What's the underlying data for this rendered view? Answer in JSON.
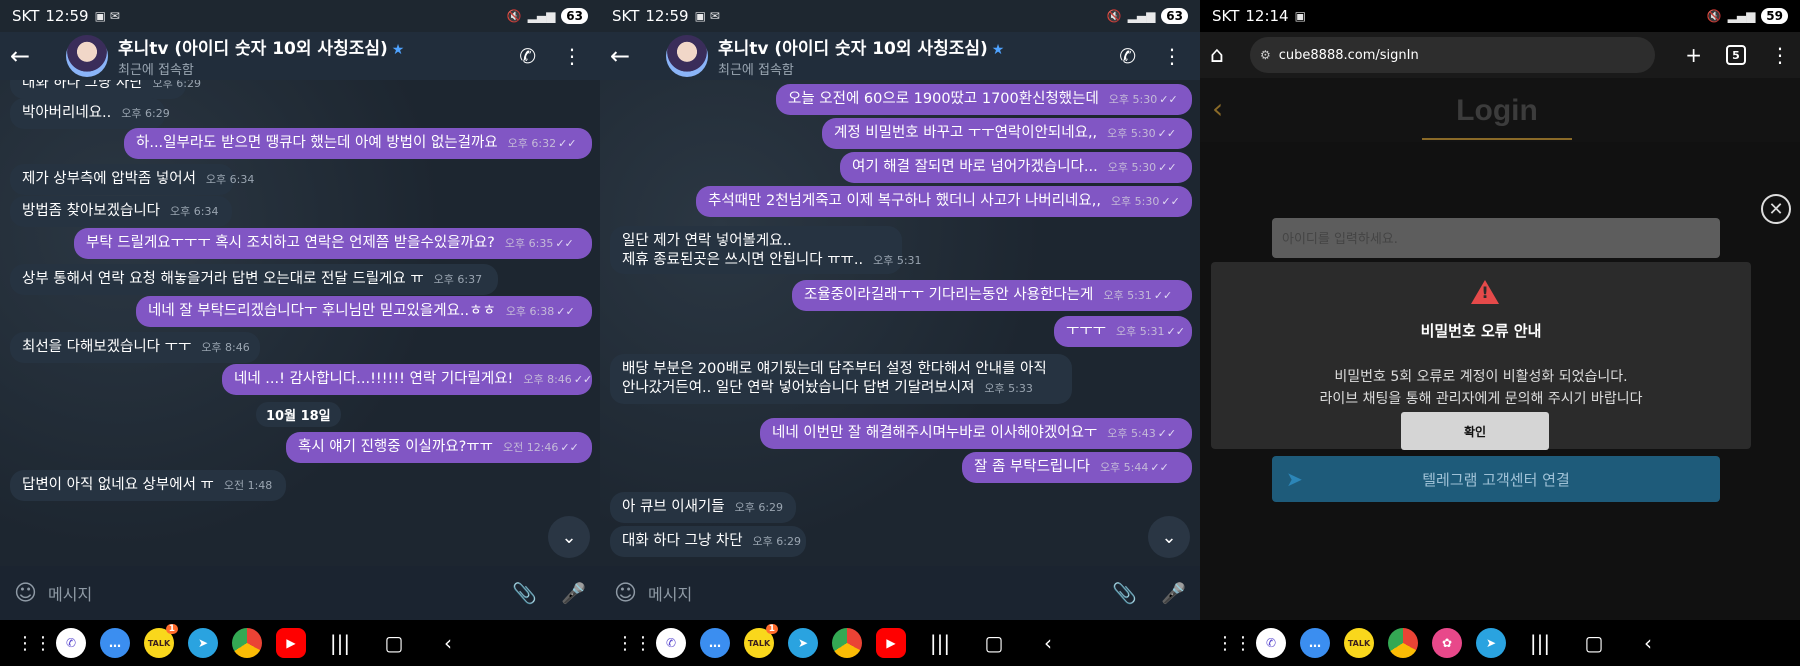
{
  "phones": [
    {
      "status": {
        "carrier": "SKT",
        "time": "12:59",
        "battery": "63"
      },
      "chat": {
        "title": "후니tv (아이디 숫자 10외 사칭조심)",
        "subtitle": "최근에 접속함"
      },
      "input_placeholder": "메시지",
      "messages": [
        {
          "type": "in",
          "text": "대화 하다 그냥 차단",
          "time": "오후 6:29"
        },
        {
          "type": "in",
          "text": "박아버리네요..",
          "time": "오후 6:29"
        },
        {
          "type": "out",
          "text": "하...일부라도 받으면 땡큐다 했는데 아예 방법이 없는걸까요",
          "time": "오후 6:32"
        },
        {
          "type": "in",
          "text": "제가 상부측에 압박좀 넣어서",
          "time": "오후 6:34"
        },
        {
          "type": "in",
          "text": "방법좀 찾아보겠습니다",
          "time": "오후 6:34"
        },
        {
          "type": "out",
          "text": "부탁 드릴게요ㅜㅜㅜ 혹시 조치하고 연락은 언제쯤 받을수있을까요?",
          "time": "오후 6:35"
        },
        {
          "type": "in",
          "text": "상부 통해서 연락 요청 해놓을거라 답변 오는대로 전달 드릴게요 ㅠ",
          "time": "오후 6:37"
        },
        {
          "type": "out",
          "text": "네네 잘 부탁드리겠습니다ㅜ 후니님만 믿고있을게요..ㅎㅎ",
          "time": "오후 6:38"
        },
        {
          "type": "in",
          "text": "최선을 다해보겠습니다 ㅜㅜ",
          "time": "오후 8:46"
        },
        {
          "type": "out",
          "text": "네네 ...! 감사합니다...!!!!!! 연락 기다릴게요!",
          "time": "오후 8:46"
        },
        {
          "type": "date",
          "text": "10월 18일"
        },
        {
          "type": "out",
          "text": "혹시 얘기 진행중 이실까요?ㅠㅠ",
          "time": "오전 12:46"
        },
        {
          "type": "in",
          "text": "답변이 아직 없네요 상부에서 ㅠ",
          "time": "오전 1:48"
        }
      ]
    },
    {
      "status": {
        "carrier": "SKT",
        "time": "12:59",
        "battery": "63"
      },
      "chat": {
        "title": "후니tv (아이디 숫자 10외 사칭조심)",
        "subtitle": "최근에 접속함"
      },
      "input_placeholder": "메시지",
      "messages": [
        {
          "type": "out",
          "text": "오늘 오전에 60으로 1900땄고 1700환신청했는데",
          "time": "오후 5:30"
        },
        {
          "type": "out",
          "text": "계정 비밀번호 바꾸고 ㅜㅜ연락이안되네요,,",
          "time": "오후 5:30"
        },
        {
          "type": "out",
          "text": "여기 해결 잘되면 바로 넘어가겠습니다...",
          "time": "오후 5:30"
        },
        {
          "type": "out",
          "text": "추석때만 2천넘게죽고 이제 복구하나 했더니 사고가 나버리네요,,",
          "time": "오후 5:30"
        },
        {
          "type": "in",
          "text": "일단 제가 연락 넣어볼게요..",
          "text2": "제휴 종료된곳은 쓰시면 안됩니다 ㅠㅠ..",
          "time": "오후 5:31"
        },
        {
          "type": "out",
          "text": "조율중이라길래ㅜㅜ 기다리는동안 사용한다는게",
          "time": "오후 5:31"
        },
        {
          "type": "out",
          "text": "ㅜㅜㅜ",
          "time": "오후 5:31"
        },
        {
          "type": "in",
          "text": "배당 부분은 200배로 얘기됬는데 담주부터 설정 한다해서 안내를 아직",
          "text2": "안나갔거든여.. 일단 연락 넣어놨습니다 답변 기달려보시져",
          "time": "오후 5:33"
        },
        {
          "type": "out",
          "text": "네네 이번만 잘 해결해주시며누바로 이사해야겠어요ㅜ",
          "time": "오후 5:43"
        },
        {
          "type": "out",
          "text": "잘 좀 부탁드립니다",
          "time": "오후 5:44"
        },
        {
          "type": "in",
          "text": "아 큐브 이새기들",
          "time": "오후 6:29"
        },
        {
          "type": "in",
          "text": "대화 하다 그냥 차단",
          "time": "오후 6:29"
        }
      ]
    }
  ],
  "browser": {
    "status": {
      "carrier": "SKT",
      "time": "12:14",
      "battery": "59"
    },
    "url": "cube8888.com/signIn",
    "tab_count": "5",
    "page_title": "Login",
    "id_placeholder": "아이디를 입력하세요.",
    "telegram_button": "텔레그램 고객센터 연결",
    "modal": {
      "title": "비밀번호 오류 안내",
      "line1": "비밀번호 5회 오류로 계정이 비활성화 되었습니다.",
      "line2": "라이브 채팅을 통해 관리자에게 문의해 주시기 바랍니다",
      "confirm": "확인"
    }
  },
  "dock": {
    "talk_label": "TALK",
    "talk_badge": "1"
  },
  "colors": {
    "outgoing": "#8156c4",
    "incoming": "#263341",
    "header": "#212d3b"
  }
}
